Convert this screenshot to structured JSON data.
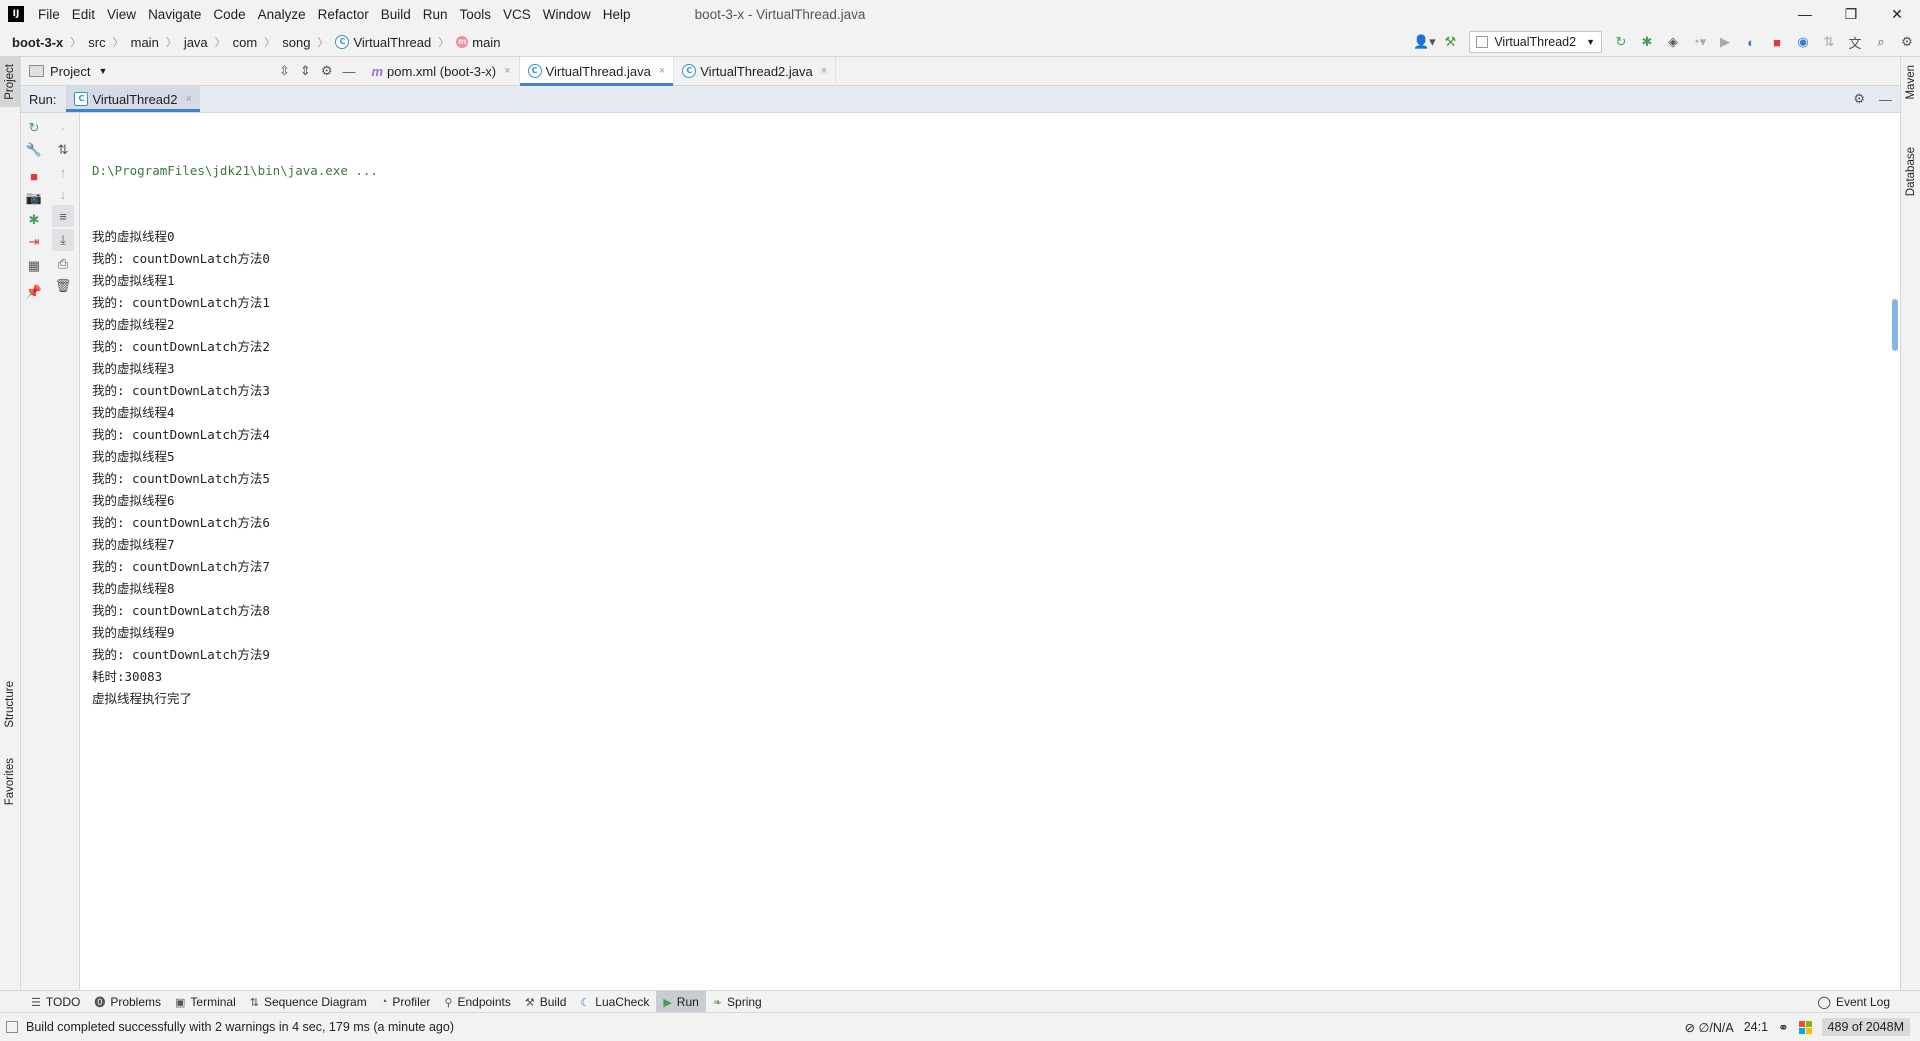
{
  "menubar": {
    "logo": "IJ",
    "items": [
      "File",
      "Edit",
      "View",
      "Navigate",
      "Code",
      "Analyze",
      "Refactor",
      "Build",
      "Run",
      "Tools",
      "VCS",
      "Window",
      "Help"
    ],
    "window_title": "boot-3-x - VirtualThread.java",
    "controls": [
      "—",
      "❐",
      "✕"
    ]
  },
  "breadcrumb": {
    "project": "boot-3-x",
    "parts": [
      "src",
      "main",
      "java",
      "com",
      "song"
    ],
    "class_name": "VirtualThread",
    "method_name": "main"
  },
  "run_config": {
    "name": "VirtualThread2"
  },
  "tabs": {
    "project_label": "Project",
    "files": [
      {
        "label": "pom.xml (boot-3-x)"
      },
      {
        "label": "VirtualThread.java"
      },
      {
        "label": "VirtualThread2.java"
      }
    ]
  },
  "run_window": {
    "label": "Run:",
    "tab": "VirtualThread2"
  },
  "console": {
    "command": "D:\\ProgramFiles\\jdk21\\bin\\java.exe ...",
    "lines": [
      "我的虚拟线程0",
      "我的: countDownLatch方法0",
      "我的虚拟线程1",
      "我的: countDownLatch方法1",
      "我的虚拟线程2",
      "我的: countDownLatch方法2",
      "我的虚拟线程3",
      "我的: countDownLatch方法3",
      "我的虚拟线程4",
      "我的: countDownLatch方法4",
      "我的虚拟线程5",
      "我的: countDownLatch方法5",
      "我的虚拟线程6",
      "我的: countDownLatch方法6",
      "我的虚拟线程7",
      "我的: countDownLatch方法7",
      "我的虚拟线程8",
      "我的: countDownLatch方法8",
      "我的虚拟线程9",
      "我的: countDownLatch方法9",
      "耗时:30083",
      "虚拟线程执行完了"
    ]
  },
  "stripes": {
    "left_top": "Project",
    "left_structure": "Structure",
    "left_favorites": "Favorites",
    "right_maven": "Maven",
    "right_database": "Database"
  },
  "bottom_tabs": [
    {
      "label": "TODO",
      "icon": "list-icon"
    },
    {
      "label": "Problems",
      "icon": "problems-icon"
    },
    {
      "label": "Terminal",
      "icon": "terminal-icon"
    },
    {
      "label": "Sequence Diagram",
      "icon": "sequence-icon"
    },
    {
      "label": "Profiler",
      "icon": "profiler-icon"
    },
    {
      "label": "Endpoints",
      "icon": "endpoints-icon"
    },
    {
      "label": "Build",
      "icon": "build-icon"
    },
    {
      "label": "LuaCheck",
      "icon": "luacheck-icon"
    },
    {
      "label": "Run",
      "icon": "run-icon"
    },
    {
      "label": "Spring",
      "icon": "spring-icon"
    }
  ],
  "event_log": "Event Log",
  "status": {
    "message": "Build completed successfully with 2 warnings in 4 sec, 179 ms (a minute ago)",
    "vcs": "∅/N/A",
    "position": "24:1",
    "memory": "489 of 2048M"
  },
  "colors": {
    "accent": "#4083c9",
    "console_cmd": "#3c7a3c",
    "stop_red": "#db3b3b",
    "run_green": "#499c54"
  }
}
